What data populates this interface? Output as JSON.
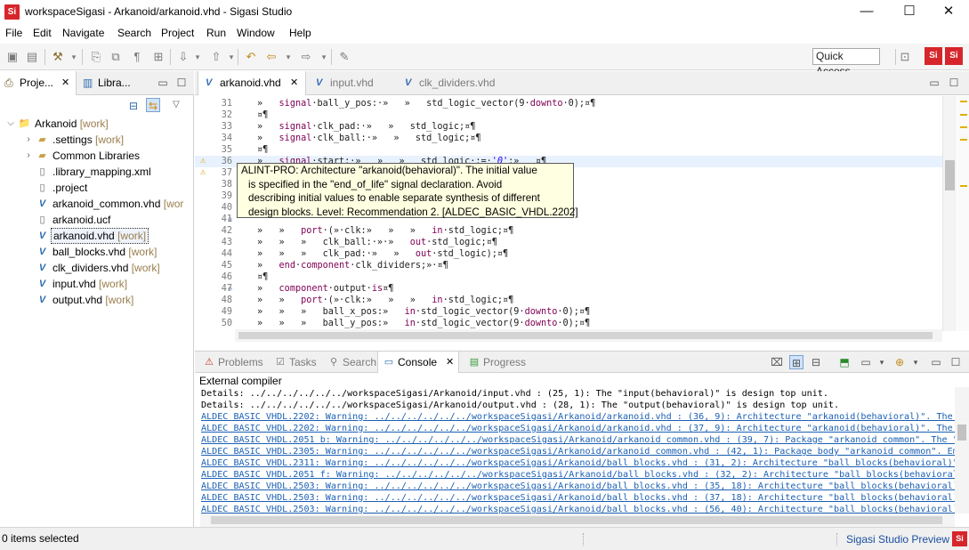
{
  "window": {
    "logo_text": "Si",
    "title": "workspaceSigasi - Arkanoid/arkanoid.vhd - Sigasi Studio",
    "minimize": "—",
    "maximize": "☐",
    "close": "✕"
  },
  "menu": [
    "File",
    "Edit",
    "Navigate",
    "Search",
    "Project",
    "Run",
    "Window",
    "Help"
  ],
  "toolbar": {
    "quick_access_label": "Quick Access",
    "perspective_1": "Si",
    "perspective_2": "Si"
  },
  "left_panel": {
    "tabs": [
      {
        "label": "Proje...",
        "icon": "project-explorer-icon"
      },
      {
        "label": "Libra...",
        "icon": "library-icon"
      }
    ],
    "tree": [
      {
        "label": "Arkanoid",
        "suffix": "[work]",
        "level": 0,
        "expanded": true,
        "icon": "project-icon"
      },
      {
        "label": ".settings",
        "suffix": "[work]",
        "level": 1,
        "expanded": false,
        "icon": "folder-icon"
      },
      {
        "label": "Common Libraries",
        "suffix": "",
        "level": 1,
        "expanded": false,
        "icon": "folder-icon"
      },
      {
        "label": ".library_mapping.xml",
        "suffix": "",
        "level": 1,
        "icon": "file-icon"
      },
      {
        "label": ".project",
        "suffix": "",
        "level": 1,
        "icon": "file-icon"
      },
      {
        "label": "arkanoid_common.vhd",
        "suffix": "[wor",
        "level": 1,
        "icon": "vhdl-file-icon"
      },
      {
        "label": "arkanoid.ucf",
        "suffix": "",
        "level": 1,
        "icon": "file-icon"
      },
      {
        "label": "arkanoid.vhd",
        "suffix": "[work]",
        "level": 1,
        "icon": "vhdl-file-icon",
        "selected": true
      },
      {
        "label": "ball_blocks.vhd",
        "suffix": "[work]",
        "level": 1,
        "icon": "vhdl-file-icon"
      },
      {
        "label": "clk_dividers.vhd",
        "suffix": "[work]",
        "level": 1,
        "icon": "vhdl-file-icon"
      },
      {
        "label": "input.vhd",
        "suffix": "[work]",
        "level": 1,
        "icon": "vhdl-file-icon"
      },
      {
        "label": "output.vhd",
        "suffix": "[work]",
        "level": 1,
        "icon": "vhdl-file-icon"
      }
    ]
  },
  "editor": {
    "tabs": [
      {
        "label": "arkanoid.vhd",
        "active": true,
        "close": "✕"
      },
      {
        "label": "input.vhd",
        "active": false
      },
      {
        "label": "clk_dividers.vhd",
        "active": false
      }
    ],
    "lines": [
      {
        "num": "31",
        "html": "»   <span class=\"kw\">signal</span>·ball_y_pos:·»   »   std_logic_vector(9·<span class=\"kw\">downto</span>·0);¤¶"
      },
      {
        "num": "32",
        "html": "¤¶"
      },
      {
        "num": "33",
        "html": "»   <span class=\"kw\">signal</span>·clk_pad:·»   »   std_logic;¤¶"
      },
      {
        "num": "34",
        "html": "»   <span class=\"kw\">signal</span>·clk_ball:·»   »   std_logic;¤¶"
      },
      {
        "num": "35",
        "html": "¤¶"
      },
      {
        "num": "36",
        "html": "»   <span class=\"kw\">signal</span>·start:·»   »   »   std_logic·:=·<span class=\"str\">'0'</span>;»   ¤¶",
        "warn": true,
        "current": true
      },
      {
        "num": "37",
        "html": "",
        "warn": true
      },
      {
        "num": "38",
        "html": ""
      },
      {
        "num": "39",
        "html": ""
      },
      {
        "num": "40",
        "html": ""
      },
      {
        "num": "41",
        "html": "",
        "fold": true
      },
      {
        "num": "42",
        "html": "»   »   <span class=\"kw\">port</span>·(»·clk:»   »   »   <span class=\"kw\">in</span>·std_logic;¤¶"
      },
      {
        "num": "43",
        "html": "»   »   »   clk_ball:·»·»   <span class=\"kw\">out</span>·std_logic;¤¶"
      },
      {
        "num": "44",
        "html": "»   »   »   clk_pad:·»   »   <span class=\"kw\">out</span>·std_logic);¤¶"
      },
      {
        "num": "45",
        "html": "»   <span class=\"kw\">end</span>·<span class=\"kw\">component</span>·clk_dividers;»·¤¶"
      },
      {
        "num": "46",
        "html": "¤¶"
      },
      {
        "num": "47",
        "html": "»   <span class=\"kw\">component</span>·output·<span class=\"kw\">is</span>¤¶",
        "fold": true
      },
      {
        "num": "48",
        "html": "»   »   <span class=\"kw\">port</span>·(»·clk:»   »   »   <span class=\"kw\">in</span>·std_logic;¤¶"
      },
      {
        "num": "49",
        "html": "»   »   »   ball_x_pos:»   <span class=\"kw\">in</span>·std_logic_vector(9·<span class=\"kw\">downto</span>·0);¤¶"
      },
      {
        "num": "50",
        "html": "»   »   »   ball_y_pos:»   <span class=\"kw\">in</span>·std_logic_vector(9·<span class=\"kw\">downto</span>·0);¤¶"
      }
    ],
    "tooltip": [
      "ALINT-PRO: Architecture \"arkanoid(behavioral)\". The initial value",
      "is specified in the \"end_of_life\" signal declaration. Avoid",
      "describing initial values to enable separate synthesis of different",
      "design blocks. Level: Recommendation 2. [ALDEC_BASIC_VHDL.2202]"
    ]
  },
  "console_panel": {
    "tabs": [
      {
        "label": "Problems",
        "active": false,
        "icon": "problems-icon"
      },
      {
        "label": "Tasks",
        "active": false,
        "icon": "tasks-icon"
      },
      {
        "label": "Search",
        "active": false,
        "icon": "search-icon"
      },
      {
        "label": "Console",
        "active": true,
        "icon": "console-icon"
      },
      {
        "label": "Progress",
        "active": false,
        "icon": "progress-icon"
      }
    ],
    "title": "External compiler",
    "lines": [
      {
        "text": "Details: ../../../../../../workspaceSigasi/Arkanoid/input.vhd : (25, 1): The \"input(behavioral)\" is design top unit.",
        "type": "det"
      },
      {
        "text": "Details: ../../../../../../workspaceSigasi/Arkanoid/output.vhd : (28, 1): The \"output(behavioral)\" is design top unit.",
        "type": "det"
      },
      {
        "text": "ALDEC BASIC VHDL.2202: Warning: ../../../../../../workspaceSigasi/Arkanoid/arkanoid.vhd : (36, 9): Architecture \"arkanoid(behavioral)\". The i",
        "type": "lnk"
      },
      {
        "text": "ALDEC BASIC VHDL.2202: Warning: ../../../../../../workspaceSigasi/Arkanoid/arkanoid.vhd : (37, 9): Architecture \"arkanoid(behavioral)\". The i",
        "type": "lnk"
      },
      {
        "text": "ALDEC BASIC VHDL.2051 b: Warning: ../../../../../../workspaceSigasi/Arkanoid/arkanoid common.vhd : (39, 7): Package \"arkanoid common\". The \"m",
        "type": "lnk"
      },
      {
        "text": "ALDEC BASIC VHDL.2305: Warning: ../../../../../../workspaceSigasi/Arkanoid/arkanoid common.vhd : (42, 1): Package body \"arkanoid common\". Emp",
        "type": "lnk"
      },
      {
        "text": "ALDEC BASIC VHDL.2311: Warning: ../../../../../../workspaceSigasi/Arkanoid/ball blocks.vhd : (31, 2): Architecture \"ball blocks(behavioral)\".",
        "type": "lnk"
      },
      {
        "text": "ALDEC BASIC VHDL.2051 f: Warning: ../../../../../../workspaceSigasi/Arkanoid/ball blocks.vhd : (32, 2): Architecture \"ball blocks(behavioral)",
        "type": "lnk"
      },
      {
        "text": "ALDEC BASIC VHDL.2503: Warning: ../../../../../../workspaceSigasi/Arkanoid/ball blocks.vhd : (35, 18): Architecture \"ball blocks(behavioral)",
        "type": "lnk"
      },
      {
        "text": "ALDEC BASIC VHDL.2503: Warning: ../../../../../../workspaceSigasi/Arkanoid/ball blocks.vhd : (37, 18): Architecture \"ball blocks(behavioral)",
        "type": "lnk"
      },
      {
        "text": "ALDEC BASIC VHDL.2503: Warning: ../../../../../../workspaceSigasi/Arkanoid/ball blocks.vhd : (56, 40): Architecture \"ball blocks(behavioral)",
        "type": "lnk"
      }
    ]
  },
  "status": {
    "left": "0 items selected",
    "right": "Sigasi Studio Preview"
  }
}
